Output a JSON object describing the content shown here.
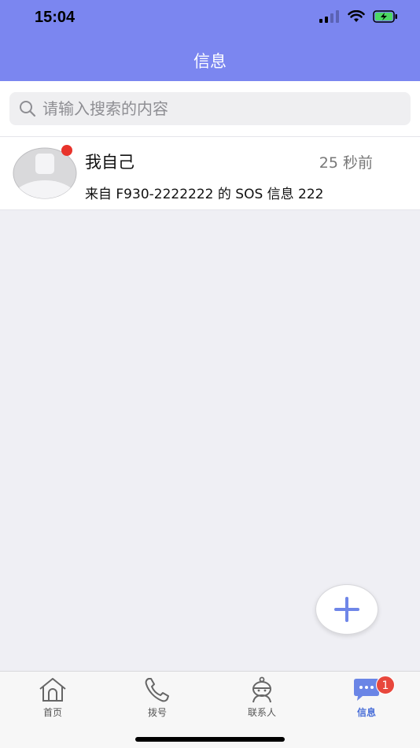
{
  "status": {
    "time": "15:04"
  },
  "header": {
    "title": "信息"
  },
  "search": {
    "placeholder": "请输入搜索的内容"
  },
  "messages": [
    {
      "name": "我自己",
      "time": "25 秒前",
      "preview": "来自 F930-2222222 的 SOS 信息 222",
      "unread": true
    }
  ],
  "tabs": [
    {
      "label": "首页",
      "icon": "home-icon"
    },
    {
      "label": "拨号",
      "icon": "phone-icon"
    },
    {
      "label": "联系人",
      "icon": "contacts-icon"
    },
    {
      "label": "信息",
      "icon": "chat-icon",
      "badge": "1",
      "active": true
    }
  ],
  "colors": {
    "header": "#7b86f0",
    "accent": "#4a6fd8",
    "badge": "#e8473c",
    "unread": "#e8332b"
  }
}
